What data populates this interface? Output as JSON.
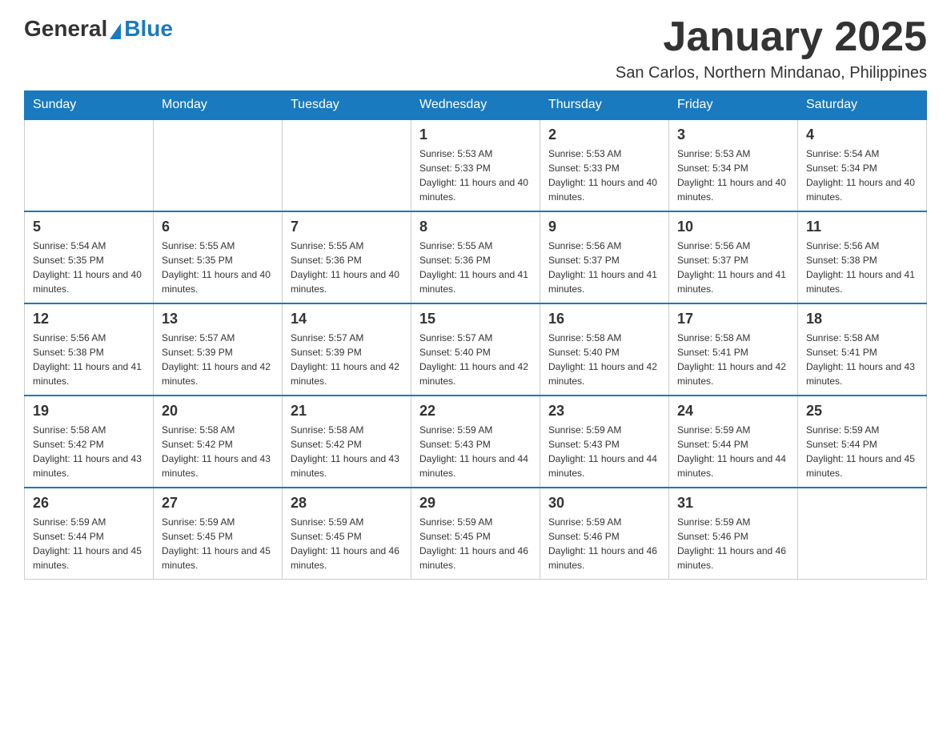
{
  "logo": {
    "general": "General",
    "blue": "Blue"
  },
  "title": "January 2025",
  "location": "San Carlos, Northern Mindanao, Philippines",
  "weekdays": [
    "Sunday",
    "Monday",
    "Tuesday",
    "Wednesday",
    "Thursday",
    "Friday",
    "Saturday"
  ],
  "weeks": [
    [
      {
        "day": "",
        "sunrise": "",
        "sunset": "",
        "daylight": ""
      },
      {
        "day": "",
        "sunrise": "",
        "sunset": "",
        "daylight": ""
      },
      {
        "day": "",
        "sunrise": "",
        "sunset": "",
        "daylight": ""
      },
      {
        "day": "1",
        "sunrise": "Sunrise: 5:53 AM",
        "sunset": "Sunset: 5:33 PM",
        "daylight": "Daylight: 11 hours and 40 minutes."
      },
      {
        "day": "2",
        "sunrise": "Sunrise: 5:53 AM",
        "sunset": "Sunset: 5:33 PM",
        "daylight": "Daylight: 11 hours and 40 minutes."
      },
      {
        "day": "3",
        "sunrise": "Sunrise: 5:53 AM",
        "sunset": "Sunset: 5:34 PM",
        "daylight": "Daylight: 11 hours and 40 minutes."
      },
      {
        "day": "4",
        "sunrise": "Sunrise: 5:54 AM",
        "sunset": "Sunset: 5:34 PM",
        "daylight": "Daylight: 11 hours and 40 minutes."
      }
    ],
    [
      {
        "day": "5",
        "sunrise": "Sunrise: 5:54 AM",
        "sunset": "Sunset: 5:35 PM",
        "daylight": "Daylight: 11 hours and 40 minutes."
      },
      {
        "day": "6",
        "sunrise": "Sunrise: 5:55 AM",
        "sunset": "Sunset: 5:35 PM",
        "daylight": "Daylight: 11 hours and 40 minutes."
      },
      {
        "day": "7",
        "sunrise": "Sunrise: 5:55 AM",
        "sunset": "Sunset: 5:36 PM",
        "daylight": "Daylight: 11 hours and 40 minutes."
      },
      {
        "day": "8",
        "sunrise": "Sunrise: 5:55 AM",
        "sunset": "Sunset: 5:36 PM",
        "daylight": "Daylight: 11 hours and 41 minutes."
      },
      {
        "day": "9",
        "sunrise": "Sunrise: 5:56 AM",
        "sunset": "Sunset: 5:37 PM",
        "daylight": "Daylight: 11 hours and 41 minutes."
      },
      {
        "day": "10",
        "sunrise": "Sunrise: 5:56 AM",
        "sunset": "Sunset: 5:37 PM",
        "daylight": "Daylight: 11 hours and 41 minutes."
      },
      {
        "day": "11",
        "sunrise": "Sunrise: 5:56 AM",
        "sunset": "Sunset: 5:38 PM",
        "daylight": "Daylight: 11 hours and 41 minutes."
      }
    ],
    [
      {
        "day": "12",
        "sunrise": "Sunrise: 5:56 AM",
        "sunset": "Sunset: 5:38 PM",
        "daylight": "Daylight: 11 hours and 41 minutes."
      },
      {
        "day": "13",
        "sunrise": "Sunrise: 5:57 AM",
        "sunset": "Sunset: 5:39 PM",
        "daylight": "Daylight: 11 hours and 42 minutes."
      },
      {
        "day": "14",
        "sunrise": "Sunrise: 5:57 AM",
        "sunset": "Sunset: 5:39 PM",
        "daylight": "Daylight: 11 hours and 42 minutes."
      },
      {
        "day": "15",
        "sunrise": "Sunrise: 5:57 AM",
        "sunset": "Sunset: 5:40 PM",
        "daylight": "Daylight: 11 hours and 42 minutes."
      },
      {
        "day": "16",
        "sunrise": "Sunrise: 5:58 AM",
        "sunset": "Sunset: 5:40 PM",
        "daylight": "Daylight: 11 hours and 42 minutes."
      },
      {
        "day": "17",
        "sunrise": "Sunrise: 5:58 AM",
        "sunset": "Sunset: 5:41 PM",
        "daylight": "Daylight: 11 hours and 42 minutes."
      },
      {
        "day": "18",
        "sunrise": "Sunrise: 5:58 AM",
        "sunset": "Sunset: 5:41 PM",
        "daylight": "Daylight: 11 hours and 43 minutes."
      }
    ],
    [
      {
        "day": "19",
        "sunrise": "Sunrise: 5:58 AM",
        "sunset": "Sunset: 5:42 PM",
        "daylight": "Daylight: 11 hours and 43 minutes."
      },
      {
        "day": "20",
        "sunrise": "Sunrise: 5:58 AM",
        "sunset": "Sunset: 5:42 PM",
        "daylight": "Daylight: 11 hours and 43 minutes."
      },
      {
        "day": "21",
        "sunrise": "Sunrise: 5:58 AM",
        "sunset": "Sunset: 5:42 PM",
        "daylight": "Daylight: 11 hours and 43 minutes."
      },
      {
        "day": "22",
        "sunrise": "Sunrise: 5:59 AM",
        "sunset": "Sunset: 5:43 PM",
        "daylight": "Daylight: 11 hours and 44 minutes."
      },
      {
        "day": "23",
        "sunrise": "Sunrise: 5:59 AM",
        "sunset": "Sunset: 5:43 PM",
        "daylight": "Daylight: 11 hours and 44 minutes."
      },
      {
        "day": "24",
        "sunrise": "Sunrise: 5:59 AM",
        "sunset": "Sunset: 5:44 PM",
        "daylight": "Daylight: 11 hours and 44 minutes."
      },
      {
        "day": "25",
        "sunrise": "Sunrise: 5:59 AM",
        "sunset": "Sunset: 5:44 PM",
        "daylight": "Daylight: 11 hours and 45 minutes."
      }
    ],
    [
      {
        "day": "26",
        "sunrise": "Sunrise: 5:59 AM",
        "sunset": "Sunset: 5:44 PM",
        "daylight": "Daylight: 11 hours and 45 minutes."
      },
      {
        "day": "27",
        "sunrise": "Sunrise: 5:59 AM",
        "sunset": "Sunset: 5:45 PM",
        "daylight": "Daylight: 11 hours and 45 minutes."
      },
      {
        "day": "28",
        "sunrise": "Sunrise: 5:59 AM",
        "sunset": "Sunset: 5:45 PM",
        "daylight": "Daylight: 11 hours and 46 minutes."
      },
      {
        "day": "29",
        "sunrise": "Sunrise: 5:59 AM",
        "sunset": "Sunset: 5:45 PM",
        "daylight": "Daylight: 11 hours and 46 minutes."
      },
      {
        "day": "30",
        "sunrise": "Sunrise: 5:59 AM",
        "sunset": "Sunset: 5:46 PM",
        "daylight": "Daylight: 11 hours and 46 minutes."
      },
      {
        "day": "31",
        "sunrise": "Sunrise: 5:59 AM",
        "sunset": "Sunset: 5:46 PM",
        "daylight": "Daylight: 11 hours and 46 minutes."
      },
      {
        "day": "",
        "sunrise": "",
        "sunset": "",
        "daylight": ""
      }
    ]
  ]
}
